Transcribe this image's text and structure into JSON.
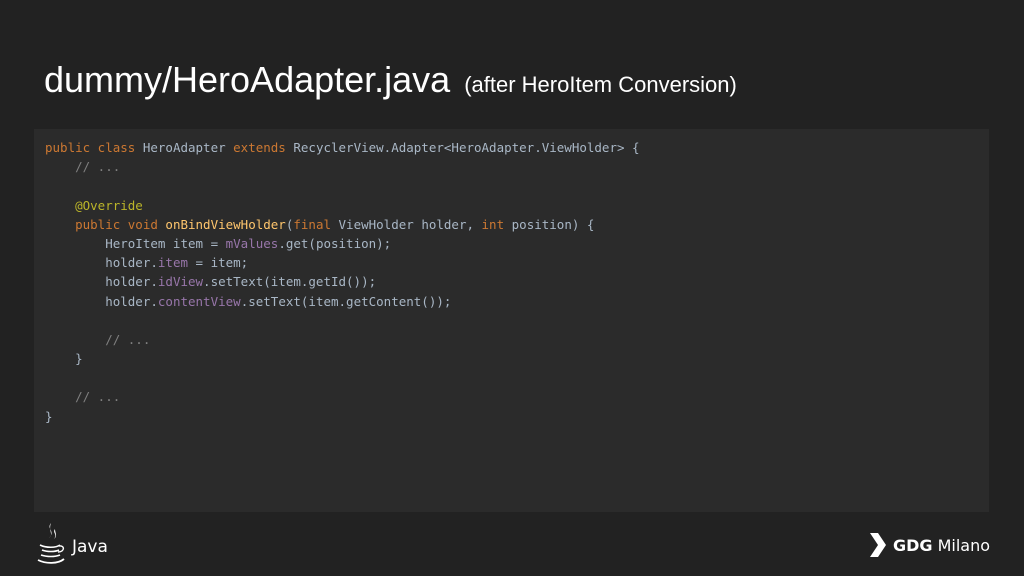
{
  "title": {
    "main": "dummy/HeroAdapter.java",
    "subtitle": "(after HeroItem Conversion)"
  },
  "code": {
    "lines": [
      [
        {
          "t": "public class ",
          "k": "keyword"
        },
        {
          "t": "HeroAdapter ",
          "k": "plain"
        },
        {
          "t": "extends ",
          "k": "keyword"
        },
        {
          "t": "RecyclerView.Adapter<HeroAdapter.ViewHolder> {",
          "k": "plain"
        }
      ],
      [
        {
          "t": "    // ...",
          "k": "comment"
        }
      ],
      [],
      [
        {
          "t": "    @Override",
          "k": "annotation"
        }
      ],
      [
        {
          "t": "    public void ",
          "k": "keyword"
        },
        {
          "t": "onBindViewHolder",
          "k": "method"
        },
        {
          "t": "(",
          "k": "plain"
        },
        {
          "t": "final ",
          "k": "keyword"
        },
        {
          "t": "ViewHolder holder, ",
          "k": "plain"
        },
        {
          "t": "int ",
          "k": "keyword"
        },
        {
          "t": "position) {",
          "k": "plain"
        }
      ],
      [
        {
          "t": "        HeroItem item = ",
          "k": "plain"
        },
        {
          "t": "mValues",
          "k": "field"
        },
        {
          "t": ".get(position);",
          "k": "plain"
        }
      ],
      [
        {
          "t": "        holder.",
          "k": "plain"
        },
        {
          "t": "item",
          "k": "field"
        },
        {
          "t": " = item;",
          "k": "plain"
        }
      ],
      [
        {
          "t": "        holder.",
          "k": "plain"
        },
        {
          "t": "idView",
          "k": "field"
        },
        {
          "t": ".setText(item.getId());",
          "k": "plain"
        }
      ],
      [
        {
          "t": "        holder.",
          "k": "plain"
        },
        {
          "t": "contentView",
          "k": "field"
        },
        {
          "t": ".setText(item.getContent());",
          "k": "plain"
        }
      ],
      [],
      [
        {
          "t": "        // ...",
          "k": "comment"
        }
      ],
      [
        {
          "t": "    }",
          "k": "plain"
        }
      ],
      [],
      [
        {
          "t": "    // ...",
          "k": "comment"
        }
      ],
      [
        {
          "t": "}",
          "k": "plain"
        }
      ]
    ]
  },
  "footer": {
    "left_logo": {
      "icon": "java-coffee-cup-icon",
      "label": "Java"
    },
    "right_logo": {
      "icon": "gdg-chevron-icon",
      "label_bold": "GDG",
      "label_light": "Milano"
    }
  },
  "colors": {
    "background": "#222222",
    "code_background": "#2b2b2b",
    "keyword": "#cc7832",
    "plain": "#a9b7c6",
    "comment": "#808080",
    "annotation": "#bbb529",
    "method": "#ffc66d",
    "field": "#9876aa"
  }
}
